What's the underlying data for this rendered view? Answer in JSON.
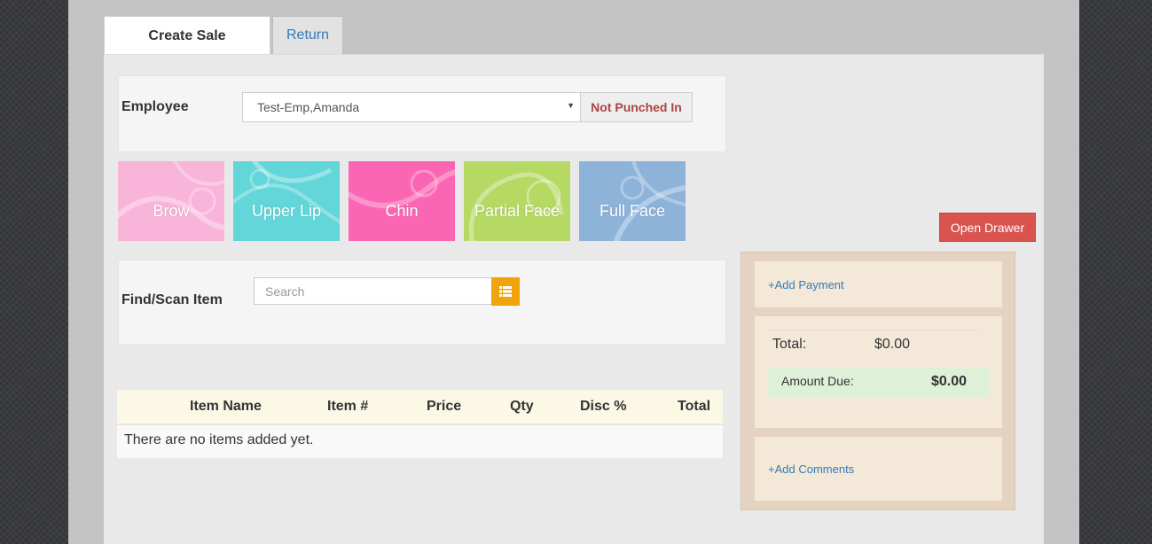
{
  "tabs": [
    {
      "label": "Create Sale"
    },
    {
      "label": "Return"
    }
  ],
  "employee": {
    "label": "Employee",
    "selected": "Test-Emp,Amanda",
    "status": "Not Punched In"
  },
  "services": [
    {
      "label": "Brow",
      "color": "#f9b4d9"
    },
    {
      "label": "Upper Lip",
      "color": "#63d6d9"
    },
    {
      "label": "Chin",
      "color": "#fb66b4"
    },
    {
      "label": "Partial Face",
      "color": "#b6d964"
    },
    {
      "label": "Full Face",
      "color": "#8db3d9"
    }
  ],
  "find": {
    "label": "Find/Scan Item",
    "placeholder": "Search",
    "list_icon": "list-icon"
  },
  "table": {
    "columns": [
      "Item Name",
      "Item #",
      "Price",
      "Qty",
      "Disc %",
      "Total"
    ],
    "empty_message": "There are no items added yet."
  },
  "drawer_button": "Open Drawer",
  "summary": {
    "add_payment": "+Add Payment",
    "total_label": "Total:",
    "total_value": "$0.00",
    "amount_due_label": "Amount Due:",
    "amount_due_value": "$0.00",
    "add_comments": "+Add Comments"
  },
  "colors": {
    "accent": "#337ab7",
    "danger": "#d9534f",
    "warning": "#f0a30a",
    "success_bg": "#dff0d8"
  }
}
